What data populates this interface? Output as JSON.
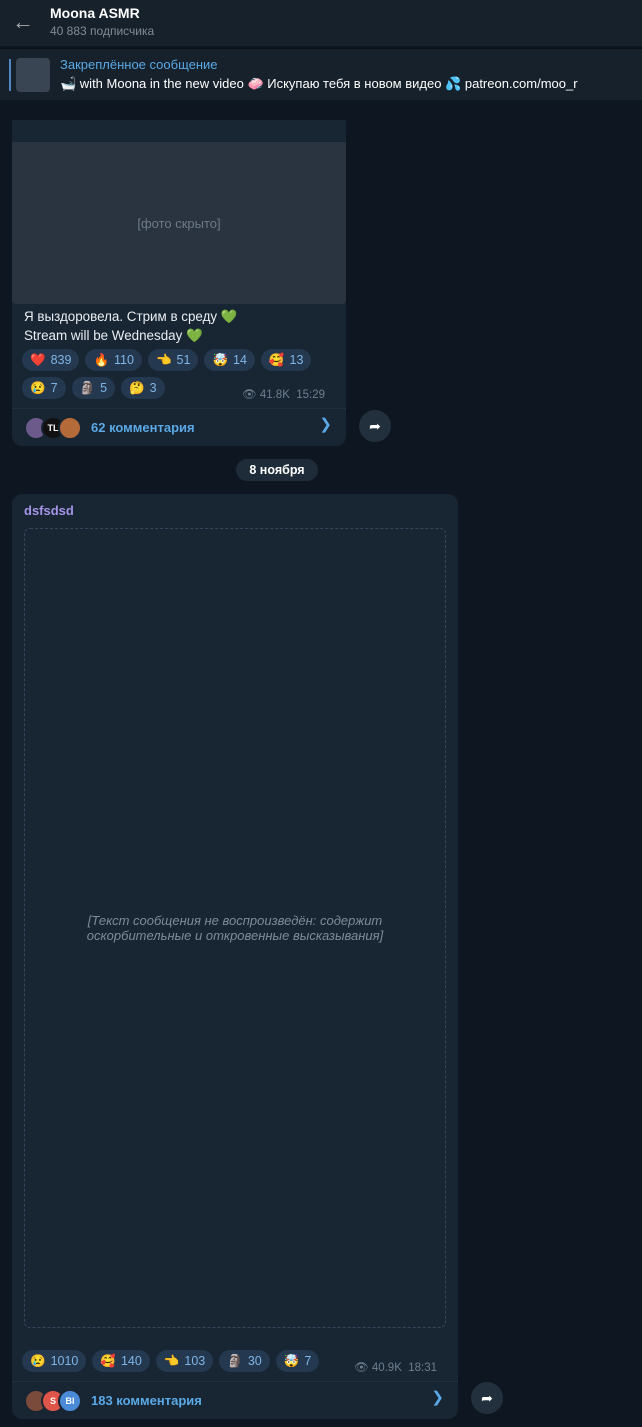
{
  "header": {
    "title": "Moona ASMR",
    "subtitle": "40 883 подписчика"
  },
  "pinned": {
    "label": "Закреплённое сообщение",
    "text": "🛁 with Moona in the new video 🧼 Искупаю тебя в новом видео 💦 patreon.com/moo_r"
  },
  "post1": {
    "media_placeholder": "[фото скрыто]",
    "text_line1": "Я выздоровела. Стрим в среду 💚",
    "text_line2": "Stream will be Wednesday 💚",
    "reactions": [
      {
        "emoji": "❤️",
        "count": "839"
      },
      {
        "emoji": "🔥",
        "count": "110"
      },
      {
        "emoji": "👈",
        "count": "51"
      },
      {
        "emoji": "🤯",
        "count": "14"
      },
      {
        "emoji": "🥰",
        "count": "13"
      },
      {
        "emoji": "😢",
        "count": "7"
      },
      {
        "emoji": "🗿",
        "count": "5"
      },
      {
        "emoji": "🤔",
        "count": "3"
      }
    ],
    "views": "41.8K",
    "time": "15:29",
    "comments_label": "62 комментария",
    "commenters": [
      "",
      "TL",
      ""
    ]
  },
  "date_divider": "8 ноября",
  "post2": {
    "author": "dsfsdsd",
    "body_placeholder": "[Текст сообщения не воспроизведён: содержит оскорбительные и откровенные высказывания]",
    "reactions": [
      {
        "emoji": "😢",
        "count": "1010"
      },
      {
        "emoji": "🥰",
        "count": "140"
      },
      {
        "emoji": "👈",
        "count": "103"
      },
      {
        "emoji": "🗿",
        "count": "30"
      },
      {
        "emoji": "🤯",
        "count": "7"
      }
    ],
    "views": "40.9K",
    "time": "18:31",
    "comments_label": "183 комментария",
    "commenters": [
      "",
      "S",
      "BI"
    ]
  },
  "colors": {
    "bg": "#0e1621",
    "bubble": "#182533",
    "accent": "#5aa9e6",
    "author": "#a695e7"
  },
  "icons": [
    "arrow-left-icon",
    "eye-icon",
    "chevron-right-icon",
    "share-icon"
  ]
}
